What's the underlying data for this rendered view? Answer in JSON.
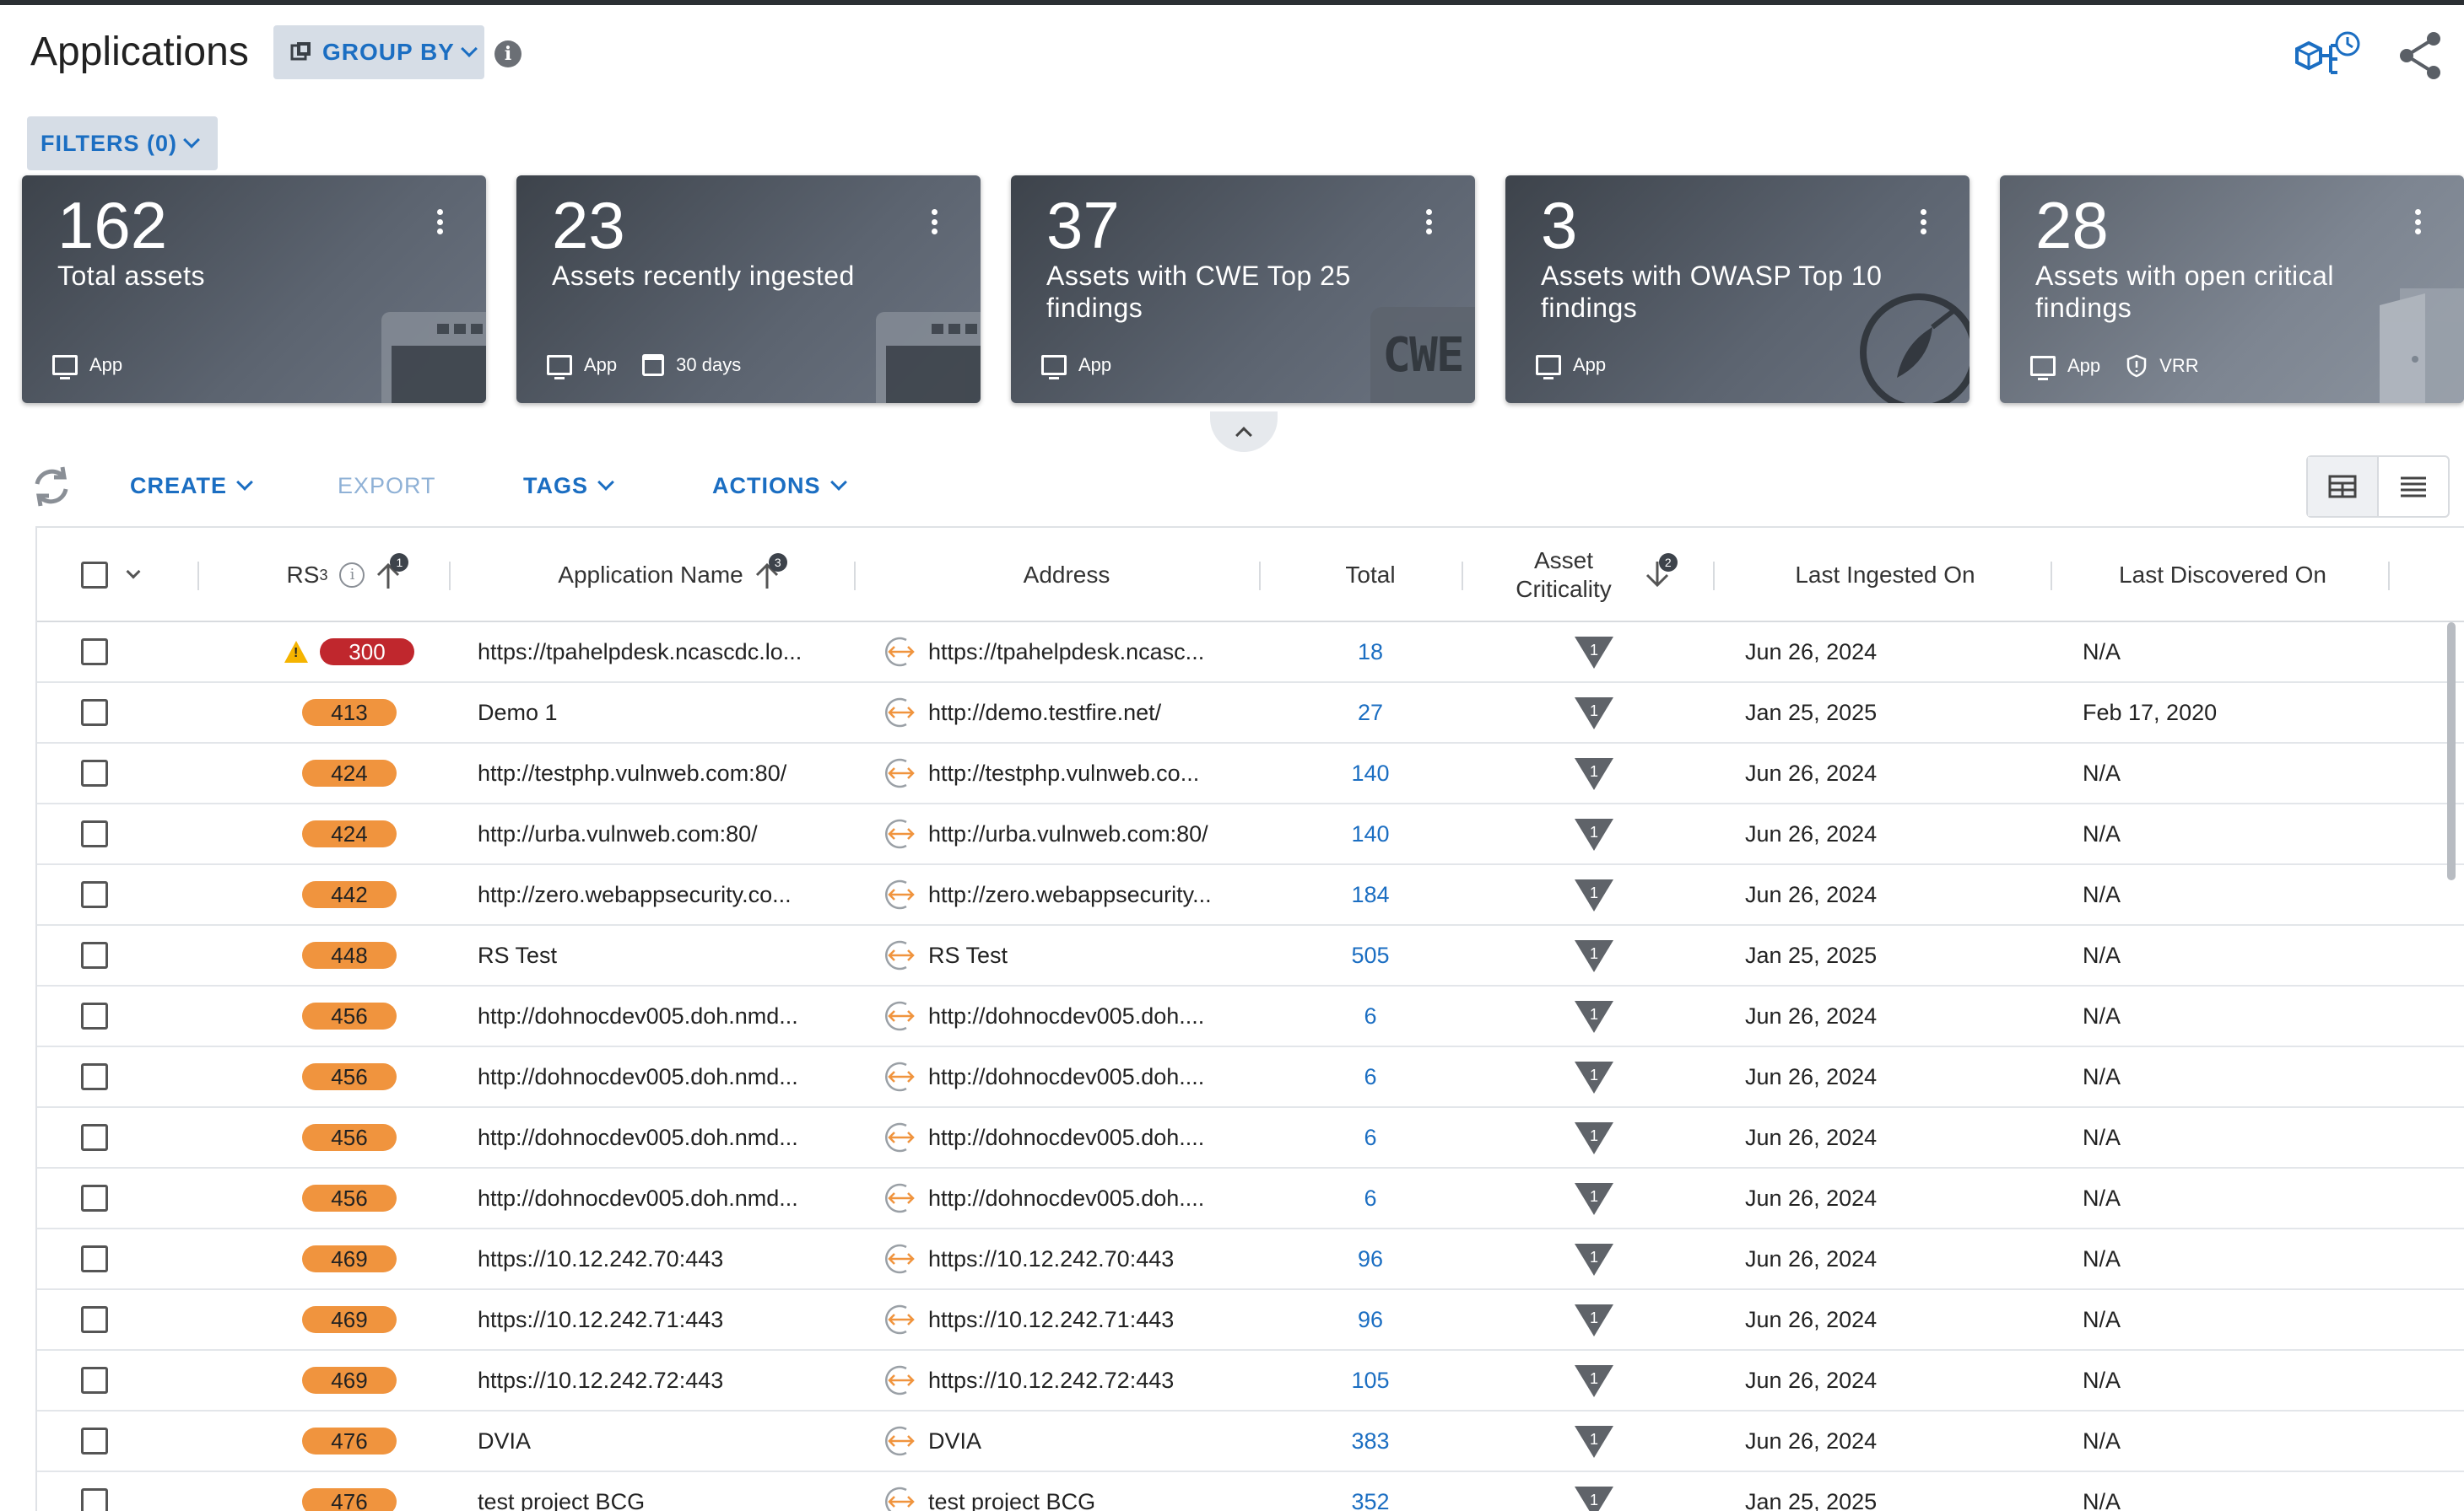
{
  "header": {
    "title": "Applications",
    "group_by_label": "GROUP BY",
    "info_glyph": "i"
  },
  "filters": {
    "label": "FILTERS (0)"
  },
  "cards": [
    {
      "number": "162",
      "label": "Total assets",
      "tags": [
        "App"
      ]
    },
    {
      "number": "23",
      "label": "Assets recently ingested",
      "tags": [
        "App",
        "30 days"
      ]
    },
    {
      "number": "37",
      "label": "Assets with CWE Top 25 findings",
      "tags": [
        "App"
      ],
      "deco_text": "CWE"
    },
    {
      "number": "3",
      "label": "Assets with OWASP Top 10 findings",
      "tags": [
        "App"
      ]
    },
    {
      "number": "28",
      "label": "Assets with open critical findings",
      "tags": [
        "App",
        "VRR"
      ]
    }
  ],
  "toolbar": {
    "create": "CREATE",
    "export": "EXPORT",
    "tags": "TAGS",
    "actions": "ACTIONS"
  },
  "table": {
    "columns": {
      "rs3": "RS",
      "rs3_sup": "3",
      "rs3_sort_badge": "1",
      "app_name": "Application Name",
      "app_name_sort_badge": "3",
      "address": "Address",
      "total": "Total",
      "asset_criticality_1": "Asset",
      "asset_criticality_2": "Criticality",
      "criticality_sort_badge": "2",
      "last_ingested": "Last Ingested On",
      "last_discovered": "Last Discovered On"
    },
    "rows": [
      {
        "rs": "300",
        "critical": true,
        "name": "https://tpahelpdesk.ncascdc.lo...",
        "address": "https://tpahelpdesk.ncasc...",
        "total": "18",
        "criticality": "1",
        "ingested": "Jun 26, 2024",
        "discovered": "N/A"
      },
      {
        "rs": "413",
        "critical": false,
        "name": "Demo 1",
        "address": "http://demo.testfire.net/",
        "total": "27",
        "criticality": "1",
        "ingested": "Jan 25, 2025",
        "discovered": "Feb 17, 2020"
      },
      {
        "rs": "424",
        "critical": false,
        "name": "http://testphp.vulnweb.com:80/",
        "address": "http://testphp.vulnweb.co...",
        "total": "140",
        "criticality": "1",
        "ingested": "Jun 26, 2024",
        "discovered": "N/A"
      },
      {
        "rs": "424",
        "critical": false,
        "name": "http://urba.vulnweb.com:80/",
        "address": "http://urba.vulnweb.com:80/",
        "total": "140",
        "criticality": "1",
        "ingested": "Jun 26, 2024",
        "discovered": "N/A"
      },
      {
        "rs": "442",
        "critical": false,
        "name": "http://zero.webappsecurity.co...",
        "address": "http://zero.webappsecurity...",
        "total": "184",
        "criticality": "1",
        "ingested": "Jun 26, 2024",
        "discovered": "N/A"
      },
      {
        "rs": "448",
        "critical": false,
        "name": "RS Test",
        "address": "RS Test",
        "total": "505",
        "criticality": "1",
        "ingested": "Jan 25, 2025",
        "discovered": "N/A"
      },
      {
        "rs": "456",
        "critical": false,
        "name": "http://dohnocdev005.doh.nmd...",
        "address": "http://dohnocdev005.doh....",
        "total": "6",
        "criticality": "1",
        "ingested": "Jun 26, 2024",
        "discovered": "N/A"
      },
      {
        "rs": "456",
        "critical": false,
        "name": "http://dohnocdev005.doh.nmd...",
        "address": "http://dohnocdev005.doh....",
        "total": "6",
        "criticality": "1",
        "ingested": "Jun 26, 2024",
        "discovered": "N/A"
      },
      {
        "rs": "456",
        "critical": false,
        "name": "http://dohnocdev005.doh.nmd...",
        "address": "http://dohnocdev005.doh....",
        "total": "6",
        "criticality": "1",
        "ingested": "Jun 26, 2024",
        "discovered": "N/A"
      },
      {
        "rs": "456",
        "critical": false,
        "name": "http://dohnocdev005.doh.nmd...",
        "address": "http://dohnocdev005.doh....",
        "total": "6",
        "criticality": "1",
        "ingested": "Jun 26, 2024",
        "discovered": "N/A"
      },
      {
        "rs": "469",
        "critical": false,
        "name": "https://10.12.242.70:443",
        "address": "https://10.12.242.70:443",
        "total": "96",
        "criticality": "1",
        "ingested": "Jun 26, 2024",
        "discovered": "N/A"
      },
      {
        "rs": "469",
        "critical": false,
        "name": "https://10.12.242.71:443",
        "address": "https://10.12.242.71:443",
        "total": "96",
        "criticality": "1",
        "ingested": "Jun 26, 2024",
        "discovered": "N/A"
      },
      {
        "rs": "469",
        "critical": false,
        "name": "https://10.12.242.72:443",
        "address": "https://10.12.242.72:443",
        "total": "105",
        "criticality": "1",
        "ingested": "Jun 26, 2024",
        "discovered": "N/A"
      },
      {
        "rs": "476",
        "critical": false,
        "name": "DVIA",
        "address": "DVIA",
        "total": "383",
        "criticality": "1",
        "ingested": "Jun 26, 2024",
        "discovered": "N/A"
      },
      {
        "rs": "476",
        "critical": false,
        "name": "test project BCG",
        "address": "test project BCG",
        "total": "352",
        "criticality": "1",
        "ingested": "Jan 25, 2025",
        "discovered": "N/A"
      }
    ]
  },
  "colors": {
    "accent": "#1b6ec2",
    "rs_orange": "#f0943e",
    "rs_critical": "#c0272d",
    "address_icon": "#f0943e",
    "card_bg": "#4a515a"
  },
  "icons": {
    "group_by": "grouping-icon",
    "info": "info-icon",
    "topology": "topology-clock-icon",
    "share": "share-icon",
    "refresh": "refresh-icon",
    "card_tag_app": "monitor-icon",
    "card_tag_days": "calendar-icon",
    "card_tag_vrr": "shield-icon",
    "address": "link-arrows-icon",
    "criticality": "criticality-triangle-icon",
    "warning": "warning-icon"
  }
}
